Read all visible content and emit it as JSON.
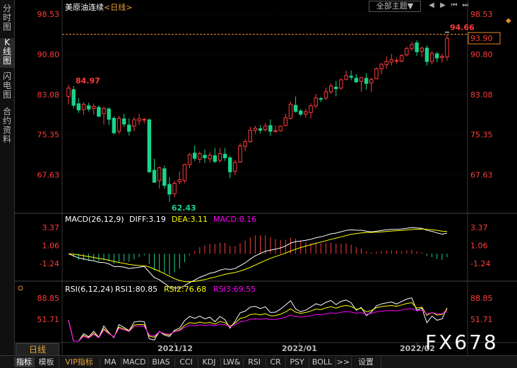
{
  "sidebar": {
    "tabs": [
      "分时图",
      "K线图",
      "闪电图",
      "合约资料"
    ],
    "active": 1
  },
  "header": {
    "title": "美原油连续",
    "period": "<日线>",
    "theme_button": "全部主题▼"
  },
  "bottom": {
    "period_tab": "日线",
    "tabs": [
      "指标",
      "模板",
      "VIP指标",
      "MA",
      "MACD",
      "BIAS",
      "CCI",
      "KDJ",
      "LW&",
      "RSI",
      "CR",
      "PSY",
      "BOLL",
      ">>",
      "设置"
    ]
  },
  "watermark": "FX678",
  "colors": {
    "up": "#ff3b3b",
    "down": "#19d38a",
    "macd_diff": "#ffffff",
    "macd_dea": "#ffff00",
    "macd_hist": "#ff00ff",
    "rsi1": "#ffffff",
    "rsi2": "#ffff00",
    "rsi3": "#ff00ff",
    "axis_label": "#ff3b3b",
    "ref_line": "#e8892a"
  },
  "chart_data": [
    {
      "type": "candlestick",
      "y_ticks": [
        "98.53",
        "90.80",
        "83.08",
        "75.35",
        "67.63"
      ],
      "ylim": [
        60.5,
        98.53
      ],
      "last_price": "93.90",
      "annotations": {
        "high": "94.66",
        "low": "62.43",
        "prior_high": "84.97"
      },
      "x_ticks": [
        "2021/12",
        "2022/01",
        "2022/02"
      ],
      "ohlc": [
        [
          82.7,
          84.97,
          81.2,
          84.3
        ],
        [
          84.0,
          84.7,
          80.4,
          81.0
        ],
        [
          81.3,
          82.4,
          79.5,
          80.1
        ],
        [
          80.2,
          81.6,
          79.2,
          81.2
        ],
        [
          80.9,
          81.5,
          79.8,
          80.3
        ],
        [
          80.4,
          81.3,
          79.2,
          80.8
        ],
        [
          80.6,
          81.0,
          78.7,
          78.9
        ],
        [
          79.4,
          80.7,
          77.3,
          80.4
        ],
        [
          80.3,
          80.6,
          77.2,
          78.3
        ],
        [
          78.5,
          78.9,
          75.4,
          75.7
        ],
        [
          76.0,
          79.0,
          75.5,
          78.5
        ],
        [
          78.4,
          79.4,
          76.8,
          77.4
        ],
        [
          77.2,
          78.5,
          75.2,
          76.0
        ],
        [
          77.0,
          78.7,
          76.0,
          78.2
        ],
        [
          78.0,
          79.4,
          77.2,
          78.4
        ],
        [
          78.2,
          78.6,
          77.5,
          78.3
        ],
        [
          78.2,
          78.5,
          68.0,
          68.2
        ],
        [
          68.5,
          70.7,
          66.1,
          66.2
        ],
        [
          66.5,
          69.2,
          65.0,
          69.0
        ],
        [
          68.8,
          69.4,
          65.0,
          65.6
        ],
        [
          65.8,
          67.2,
          62.43,
          63.9
        ],
        [
          64.0,
          66.5,
          63.3,
          66.0
        ],
        [
          66.3,
          68.3,
          65.8,
          66.7
        ],
        [
          66.5,
          69.8,
          66.0,
          69.6
        ],
        [
          69.6,
          71.8,
          68.9,
          71.5
        ],
        [
          71.8,
          73.3,
          70.3,
          70.8
        ],
        [
          70.6,
          72.1,
          69.9,
          71.7
        ],
        [
          71.4,
          72.5,
          69.9,
          70.9
        ],
        [
          70.7,
          72.0,
          70.0,
          71.4
        ],
        [
          71.3,
          72.8,
          69.9,
          70.2
        ],
        [
          70.4,
          72.8,
          70.0,
          71.7
        ],
        [
          71.6,
          72.8,
          70.3,
          70.9
        ],
        [
          70.9,
          71.3,
          67.0,
          68.2
        ],
        [
          68.3,
          70.5,
          67.6,
          70.0
        ],
        [
          70.1,
          73.7,
          69.9,
          73.2
        ],
        [
          73.1,
          74.5,
          72.2,
          74.0
        ],
        [
          74.0,
          76.9,
          73.8,
          76.2
        ],
        [
          76.2,
          77.1,
          75.5,
          76.6
        ],
        [
          76.5,
          77.2,
          75.6,
          76.2
        ],
        [
          76.3,
          77.6,
          75.9,
          77.0
        ],
        [
          77.1,
          78.3,
          75.1,
          76.0
        ],
        [
          76.0,
          77.1,
          75.8,
          76.1
        ],
        [
          76.1,
          77.1,
          75.9,
          77.0
        ],
        [
          77.1,
          79.4,
          77.0,
          78.6
        ],
        [
          78.5,
          81.7,
          78.3,
          81.2
        ],
        [
          81.0,
          82.7,
          79.6,
          79.8
        ],
        [
          79.9,
          80.3,
          78.9,
          79.3
        ],
        [
          79.3,
          80.3,
          78.6,
          79.8
        ],
        [
          79.6,
          81.4,
          78.5,
          80.9
        ],
        [
          80.9,
          83.2,
          80.5,
          82.4
        ],
        [
          82.3,
          82.6,
          81.6,
          82.2
        ],
        [
          82.4,
          84.4,
          82.0,
          83.6
        ],
        [
          83.6,
          85.2,
          83.2,
          84.7
        ],
        [
          84.5,
          85.7,
          82.7,
          84.2
        ],
        [
          84.3,
          86.2,
          84.0,
          85.9
        ],
        [
          86.0,
          87.7,
          85.8,
          86.7
        ],
        [
          86.6,
          87.7,
          85.8,
          86.4
        ],
        [
          86.2,
          87.0,
          85.3,
          85.5
        ],
        [
          85.6,
          86.5,
          83.6,
          86.3
        ],
        [
          86.2,
          87.2,
          84.0,
          85.2
        ],
        [
          85.3,
          86.3,
          83.5,
          86.0
        ],
        [
          86.1,
          88.3,
          86.0,
          88.0
        ],
        [
          88.0,
          89.1,
          87.0,
          88.9
        ],
        [
          88.8,
          90.4,
          88.0,
          89.4
        ],
        [
          89.3,
          90.9,
          88.6,
          89.8
        ],
        [
          89.6,
          90.1,
          89.0,
          89.6
        ],
        [
          89.5,
          90.8,
          89.2,
          90.6
        ],
        [
          90.7,
          92.3,
          90.4,
          91.9
        ],
        [
          91.9,
          93.2,
          91.5,
          92.7
        ],
        [
          93.0,
          93.5,
          90.5,
          91.3
        ],
        [
          91.4,
          92.3,
          90.3,
          92.0
        ],
        [
          92.0,
          92.5,
          88.6,
          89.4
        ],
        [
          89.4,
          91.4,
          88.9,
          91.0
        ],
        [
          90.9,
          91.3,
          89.3,
          90.1
        ],
        [
          90.2,
          90.9,
          89.2,
          90.4
        ],
        [
          90.3,
          94.66,
          89.6,
          93.9
        ]
      ]
    },
    {
      "type": "line",
      "indicator": "MACD",
      "label": "MACD(26,12,9)",
      "values_text": {
        "diff": "DIFF:3.19",
        "dea": "DEA:3.11",
        "macd": "MACD:0.16"
      },
      "y_ticks": [
        "3.37",
        "1.06",
        "-1.24"
      ]
    },
    {
      "type": "line",
      "indicator": "RSI",
      "label": "RSI(6,12,24)",
      "values_text": {
        "rsi1": "RSI1:80.85",
        "rsi2": "RSI2:76.68",
        "rsi3": "RSI3:69.55"
      },
      "y_ticks": [
        "88.85",
        "51.71"
      ]
    }
  ]
}
